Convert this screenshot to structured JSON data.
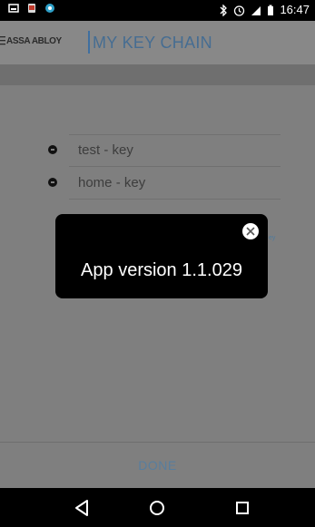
{
  "status_bar": {
    "time": "16:47",
    "icons": [
      "screenshot-icon",
      "notification-app-icon",
      "browser-icon",
      "bluetooth-icon",
      "alarm-icon",
      "signal-icon",
      "battery-icon"
    ]
  },
  "header": {
    "brand": "ASSA ABLOY",
    "title": "MY KEY CHAIN",
    "menu_icon": "menu-icon"
  },
  "keys": {
    "items": [
      {
        "label": "test - key"
      },
      {
        "label": "home - key"
      }
    ]
  },
  "background_link": "ey",
  "footer": {
    "done_label": "DONE"
  },
  "dialog": {
    "message": "App version 1.1.029",
    "close_icon": "close-icon"
  },
  "nav_bar": {
    "icons": [
      "back-icon",
      "home-icon",
      "recents-icon"
    ]
  },
  "colors": {
    "overlay_background": "#7f7f7f",
    "header_background": "#888888",
    "accent_blue": "#466d92",
    "dialog_background": "#000000"
  }
}
